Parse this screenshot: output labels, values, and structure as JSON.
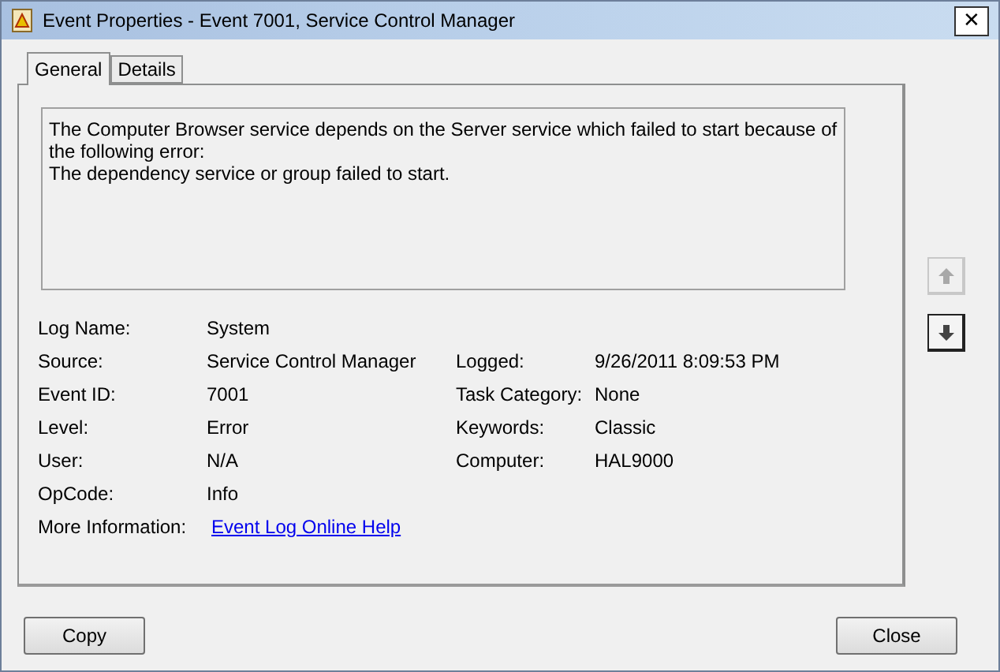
{
  "window": {
    "title": "Event Properties - Event 7001, Service Control Manager",
    "close": "✕"
  },
  "tabs": [
    {
      "label": "General",
      "selected": true
    },
    {
      "label": "Details",
      "selected": false
    }
  ],
  "message": [
    "The Computer Browser service depends on the Server service which failed to start because of the following error:",
    "The dependency service or group failed to start."
  ],
  "rows": [
    {
      "label": "Log Name:",
      "value": "System"
    },
    {
      "label": "Source:",
      "value": "Service Control Manager",
      "right": {
        "label": "Logged:",
        "value": "9/26/2011 8:09:53 PM"
      }
    },
    {
      "label": "Event ID:",
      "value": "7001",
      "right": {
        "label": "Task Category:",
        "value": "None"
      }
    },
    {
      "label": "Level:",
      "value": "Error",
      "right": {
        "label": "Keywords:",
        "value": "Classic"
      }
    },
    {
      "label": "User:",
      "value": "N/A",
      "right": {
        "label": "Computer:",
        "value": "HAL9000"
      }
    },
    {
      "label": "OpCode:",
      "value": "Info"
    },
    {
      "label": "More Information:",
      "value": "Event Log Online Help",
      "kind": "link"
    }
  ],
  "nav_buttons": [
    {
      "kind": "up",
      "disabled": true
    },
    {
      "kind": "down",
      "disabled": false
    }
  ],
  "buttons": [
    {
      "label": "Copy"
    },
    {
      "label": "Close"
    }
  ]
}
